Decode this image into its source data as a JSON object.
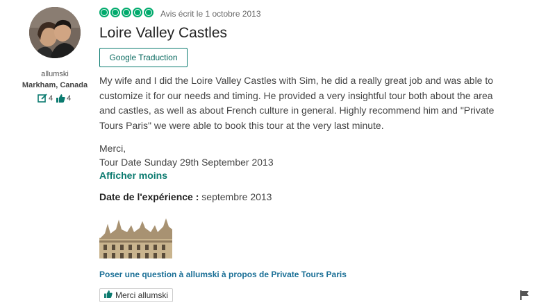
{
  "reviewer": {
    "username": "allumski",
    "location": "Markham, Canada",
    "contributions": "4",
    "helpful_votes": "4"
  },
  "review": {
    "rating_bubbles": 5,
    "date_text": "Avis écrit le 1 octobre 2013",
    "title": "Loire Valley Castles",
    "translate_label": "Google Traduction",
    "body": "My wife and I did the Loire Valley Castles with Sim, he did a really great job and was able to customize it for our needs and timing. He provided a very insightful tour both about the area and castles, as well as about French culture in general. Highly recommend him and \"Private Tours Paris\" we were able to book this tour at the very last minute.",
    "signoff": "Merci,",
    "tour_date": "Tour Date Sunday 29th September 2013",
    "show_less": "Afficher moins",
    "experience_label": "Date de l'expérience :",
    "experience_value": "septembre 2013",
    "ask_question": "Poser une question à allumski à propos de Private Tours Paris",
    "thanks_label": "Merci allumski"
  },
  "icons": {
    "review_count": "edit-icon",
    "helpful": "thumbs-up-icon",
    "flag": "flag-icon",
    "rating": "rating-bubble-icon"
  },
  "colors": {
    "accent_green": "#00aa6c",
    "link_teal": "#0a7a6f",
    "link_blue": "#1a6f96"
  }
}
